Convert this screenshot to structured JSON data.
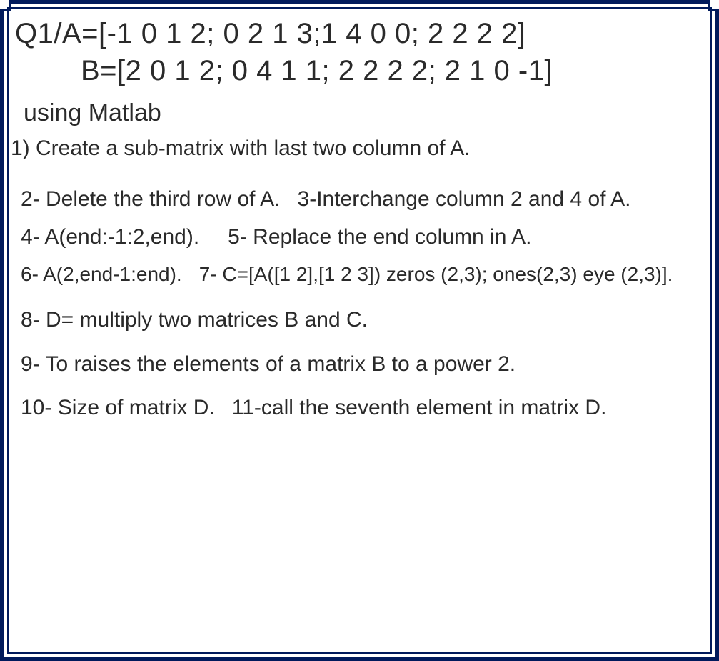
{
  "header": {
    "line1": "Q1/A=[-1 0 1 2; 0 2 1 3;1 4 0 0; 2 2 2 2]",
    "line2": "B=[2 0 1 2; 0 4 1 1; 2 2 2 2; 2 1 0 -1]"
  },
  "subtitle": "using Matlab",
  "items": {
    "q1": "1) Create a sub-matrix with last two column of A.",
    "q2": "2- Delete the third row of A.",
    "q3": "3-Interchange column 2 and 4 of A.",
    "q4": "4- A(end:-1:2,end).",
    "q5": "5- Replace the end column in A.",
    "q6": "6- A(2,end-1:end).",
    "q7": "7- C=[A([1 2],[1 2 3]) zeros (2,3); ones(2,3) eye (2,3)].",
    "q8": "8- D= multiply two matrices B and C.",
    "q9": "9- To raises the elements of a matrix B to a power 2.",
    "q10": "10- Size of matrix D.",
    "q11": "11-call the seventh element in matrix D."
  }
}
